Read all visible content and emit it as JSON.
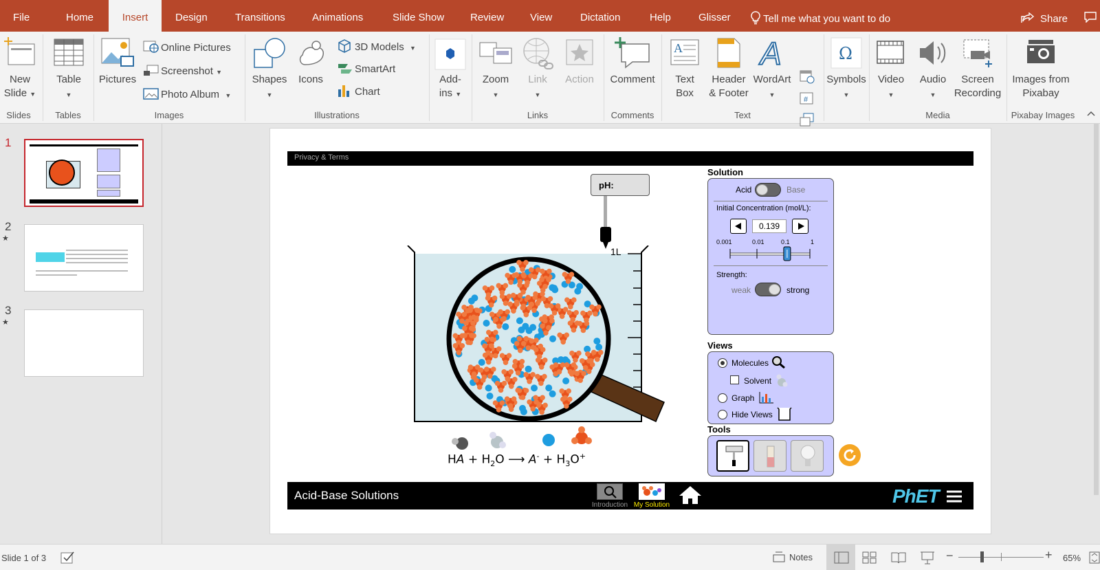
{
  "tabs": [
    "File",
    "Home",
    "Insert",
    "Design",
    "Transitions",
    "Animations",
    "Slide Show",
    "Review",
    "View",
    "Dictation",
    "Help",
    "Glisser"
  ],
  "active_tab": "Insert",
  "tell_me": "Tell me what you want to do",
  "share": "Share",
  "ribbon": {
    "new_slide": [
      "New",
      "Slide"
    ],
    "table": "Table",
    "pictures": "Pictures",
    "online_pictures": "Online Pictures",
    "screenshot": "Screenshot",
    "photo_album": "Photo Album",
    "shapes": "Shapes",
    "icons": "Icons",
    "models_3d": "3D Models",
    "smartart": "SmartArt",
    "chart": "Chart",
    "addins": [
      "Add-",
      "ins"
    ],
    "zoom": "Zoom",
    "link": "Link",
    "action": "Action",
    "comment": "Comment",
    "text_box": [
      "Text",
      "Box"
    ],
    "header_footer": [
      "Header",
      "& Footer"
    ],
    "wordart": "WordArt",
    "symbols": "Symbols",
    "video": "Video",
    "audio": "Audio",
    "screen_recording": [
      "Screen",
      "Recording"
    ],
    "images_from_pixabay": [
      "Images from",
      "Pixabay"
    ],
    "groups": {
      "slides": "Slides",
      "tables": "Tables",
      "images": "Images",
      "illustrations": "Illustrations",
      "links": "Links",
      "comments": "Comments",
      "text": "Text",
      "media": "Media",
      "pixabay": "Pixabay Images"
    }
  },
  "thumbnails": [
    {
      "num": "1",
      "star": ""
    },
    {
      "num": "2",
      "star": "★"
    },
    {
      "num": "3",
      "star": "★"
    }
  ],
  "slide": {
    "privacy": "Privacy & Terms",
    "ph_label": "pH:",
    "beaker_volume": "1L",
    "solution_title": "Solution",
    "acid": "Acid",
    "base": "Base",
    "init_conc_label": "Initial Concentration (mol/L):",
    "concentration_value": "0.139",
    "slider_ticks": [
      "0.001",
      "0.01",
      "0.1",
      "1"
    ],
    "strength_label": "Strength:",
    "weak": "weak",
    "strong": "strong",
    "views_title": "Views",
    "molecules": "Molecules",
    "solvent": "Solvent",
    "graph": "Graph",
    "hide_views": "Hide Views",
    "tools_title": "Tools",
    "sim_title": "Acid-Base Solutions",
    "screen_intro": "Introduction",
    "screen_mysolution": "My Solution",
    "phet_logo": "PhET",
    "colors": {
      "panel": "#ccccff",
      "acid_molecule": "#e8521c",
      "water_ion": "#1e9de0",
      "ribbon": "#b7472a"
    }
  },
  "status": {
    "slide_count": "Slide 1 of 3",
    "notes": "Notes",
    "zoom": "65%"
  }
}
